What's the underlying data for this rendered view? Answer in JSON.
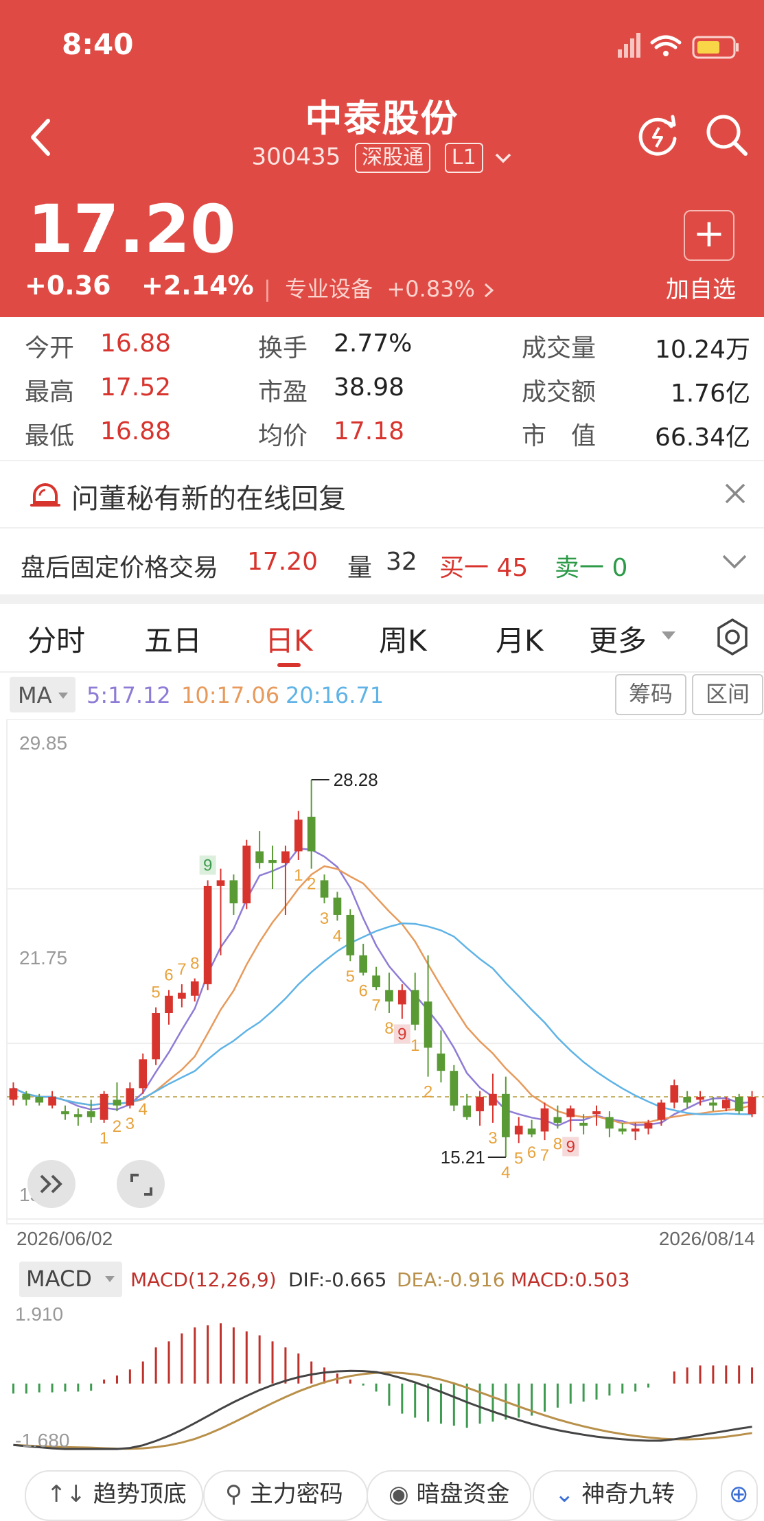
{
  "status_bar": {
    "time": "8:40"
  },
  "header": {
    "title": "中泰股份",
    "code": "300435",
    "tag_connect": "深股通",
    "tag_level": "L1",
    "price": "17.20",
    "change": "+0.36",
    "change_pct": "+2.14%",
    "industry": "专业设备",
    "industry_pct": "+0.83%",
    "add_label": "加自选",
    "add_symbol": "+"
  },
  "quote": {
    "col1": [
      {
        "label": "今开",
        "value": "16.88"
      },
      {
        "label": "最高",
        "value": "17.52"
      },
      {
        "label": "最低",
        "value": "16.88"
      }
    ],
    "col2": [
      {
        "label": "换手",
        "value": "2.77%"
      },
      {
        "label": "市盈",
        "value": "38.98"
      },
      {
        "label": "均价",
        "value": "17.18"
      }
    ],
    "col3": [
      {
        "label": "成交量",
        "value": "10.24万"
      },
      {
        "label": "成交额",
        "value": "1.76亿"
      },
      {
        "label": "市　值",
        "value": "66.34亿"
      }
    ]
  },
  "notice": {
    "text": "问董秘有新的在线回复"
  },
  "after_hours": {
    "label": "盘后固定价格交易",
    "price": "17.20",
    "vol_label": "量",
    "vol": "32",
    "buy": "买一 45",
    "sell": "卖一 0"
  },
  "tabs": [
    "分时",
    "五日",
    "日K",
    "周K",
    "月K",
    "更多"
  ],
  "active_tab": "日K",
  "ma_bar": {
    "label": "MA",
    "ma5": "5:17.12",
    "ma10": "10:17.06",
    "ma20": "20:16.71",
    "btn_chip": "筹码",
    "btn_range": "区间"
  },
  "colors": {
    "up": "#d8342e",
    "down": "#5a9a35",
    "ma5": "#8e7bd6",
    "ma10": "#e79a5b",
    "ma20": "#5fb3e6",
    "header": "#df4b44"
  },
  "chart_data": [
    {
      "type": "candlestick",
      "y_axis_labels": [
        "29.85",
        "21.75",
        "13.64"
      ],
      "ylim": [
        13.64,
        29.85
      ],
      "x_axis_labels": [
        "2026/06/02",
        "2026/08/14"
      ],
      "high_annotation": "28.28",
      "low_annotation": "15.21",
      "sequence_labels": [
        "1",
        "2",
        "3",
        "4",
        "5",
        "6",
        "7",
        "8",
        "9",
        "1",
        "2",
        "3",
        "4",
        "5",
        "6",
        "7",
        "8",
        "9",
        "1",
        "2",
        "3",
        "4",
        "5",
        "6",
        "7",
        "8",
        "9"
      ],
      "candles": [
        [
          17.2,
          17.8,
          17.0,
          17.6
        ],
        [
          17.4,
          17.5,
          17.0,
          17.2
        ],
        [
          17.3,
          17.4,
          17.0,
          17.1
        ],
        [
          17.0,
          17.5,
          16.9,
          17.3
        ],
        [
          16.8,
          17.0,
          16.5,
          16.7
        ],
        [
          16.7,
          16.9,
          16.3,
          16.6
        ],
        [
          16.8,
          17.2,
          16.4,
          16.6
        ],
        [
          16.5,
          17.5,
          16.4,
          17.4
        ],
        [
          17.2,
          17.8,
          16.8,
          17.0
        ],
        [
          17.0,
          17.8,
          16.9,
          17.6
        ],
        [
          17.6,
          18.8,
          17.4,
          18.6
        ],
        [
          18.6,
          20.4,
          18.4,
          20.2
        ],
        [
          20.2,
          21.0,
          19.8,
          20.8
        ],
        [
          20.7,
          21.2,
          20.4,
          20.9
        ],
        [
          20.8,
          21.4,
          20.6,
          21.3
        ],
        [
          21.2,
          24.8,
          21.0,
          24.6
        ],
        [
          24.6,
          25.2,
          22.2,
          24.8
        ],
        [
          24.8,
          25.0,
          23.6,
          24.0
        ],
        [
          24.0,
          26.2,
          23.8,
          26.0
        ],
        [
          25.8,
          26.5,
          25.2,
          25.4
        ],
        [
          25.5,
          26.0,
          24.5,
          25.4
        ],
        [
          25.4,
          26.0,
          23.6,
          25.8
        ],
        [
          25.8,
          27.2,
          25.5,
          26.9
        ],
        [
          27.0,
          28.28,
          25.2,
          25.8
        ],
        [
          24.8,
          25.0,
          24.0,
          24.2
        ],
        [
          24.2,
          24.4,
          23.4,
          23.6
        ],
        [
          23.6,
          23.8,
          22.0,
          22.2
        ],
        [
          22.2,
          22.6,
          21.5,
          21.6
        ],
        [
          21.5,
          21.8,
          21.0,
          21.1
        ],
        [
          21.0,
          21.6,
          20.2,
          20.6
        ],
        [
          20.5,
          21.2,
          20.0,
          21.0
        ],
        [
          21.0,
          21.6,
          19.6,
          19.8
        ],
        [
          20.6,
          22.2,
          18.0,
          19.0
        ],
        [
          18.8,
          19.6,
          17.8,
          18.2
        ],
        [
          18.2,
          18.4,
          16.8,
          17.0
        ],
        [
          17.0,
          17.4,
          16.5,
          16.6
        ],
        [
          16.8,
          17.5,
          16.3,
          17.3
        ],
        [
          17.0,
          18.1,
          16.4,
          17.4
        ],
        [
          17.4,
          18.0,
          15.21,
          15.9
        ],
        [
          16.0,
          16.6,
          15.7,
          16.3
        ],
        [
          16.2,
          16.5,
          15.9,
          16.0
        ],
        [
          16.1,
          17.1,
          15.8,
          16.9
        ],
        [
          16.6,
          17.0,
          16.2,
          16.4
        ],
        [
          16.6,
          17.0,
          16.1,
          16.9
        ],
        [
          16.4,
          16.7,
          16.0,
          16.3
        ],
        [
          16.7,
          17.0,
          16.3,
          16.8
        ],
        [
          16.6,
          16.8,
          15.9,
          16.2
        ],
        [
          16.2,
          16.4,
          16.0,
          16.1
        ],
        [
          16.1,
          16.4,
          15.8,
          16.2
        ],
        [
          16.2,
          16.5,
          16.0,
          16.4
        ],
        [
          16.5,
          17.2,
          16.3,
          17.1
        ],
        [
          17.1,
          17.9,
          16.9,
          17.7
        ],
        [
          17.3,
          17.5,
          16.9,
          17.1
        ],
        [
          17.2,
          17.5,
          17.0,
          17.3
        ],
        [
          17.1,
          17.3,
          16.8,
          17.0
        ],
        [
          16.9,
          17.3,
          16.8,
          17.2
        ],
        [
          17.3,
          17.4,
          16.7,
          16.8
        ],
        [
          16.7,
          17.5,
          16.6,
          17.3
        ]
      ]
    },
    {
      "type": "bar",
      "title": "MACD(12,26,9)",
      "dif": "DIF:-0.665",
      "dea": "DEA:-0.916",
      "macd": "MACD:0.503",
      "selector": "MACD",
      "y_axis_labels": [
        "1.910",
        "-1.680"
      ],
      "ylim": [
        -1.68,
        1.91
      ],
      "values": [
        -0.25,
        -0.25,
        -0.22,
        -0.22,
        -0.2,
        -0.2,
        -0.18,
        0.1,
        0.2,
        0.35,
        0.55,
        0.9,
        1.05,
        1.25,
        1.4,
        1.45,
        1.5,
        1.4,
        1.3,
        1.2,
        1.05,
        0.9,
        0.75,
        0.55,
        0.4,
        0.25,
        0.1,
        -0.05,
        -0.2,
        -0.55,
        -0.75,
        -0.85,
        -0.95,
        -1.0,
        -1.05,
        -1.1,
        -1.0,
        -0.95,
        -0.9,
        -0.85,
        -0.8,
        -0.7,
        -0.6,
        -0.5,
        -0.45,
        -0.4,
        -0.3,
        -0.25,
        -0.2,
        -0.1,
        0.0,
        0.3,
        0.4,
        0.45,
        0.45,
        0.45,
        0.45,
        0.4
      ]
    }
  ],
  "bottom_tools": [
    "趋势顶底",
    "主力密码",
    "暗盘资金",
    "神奇九转"
  ]
}
